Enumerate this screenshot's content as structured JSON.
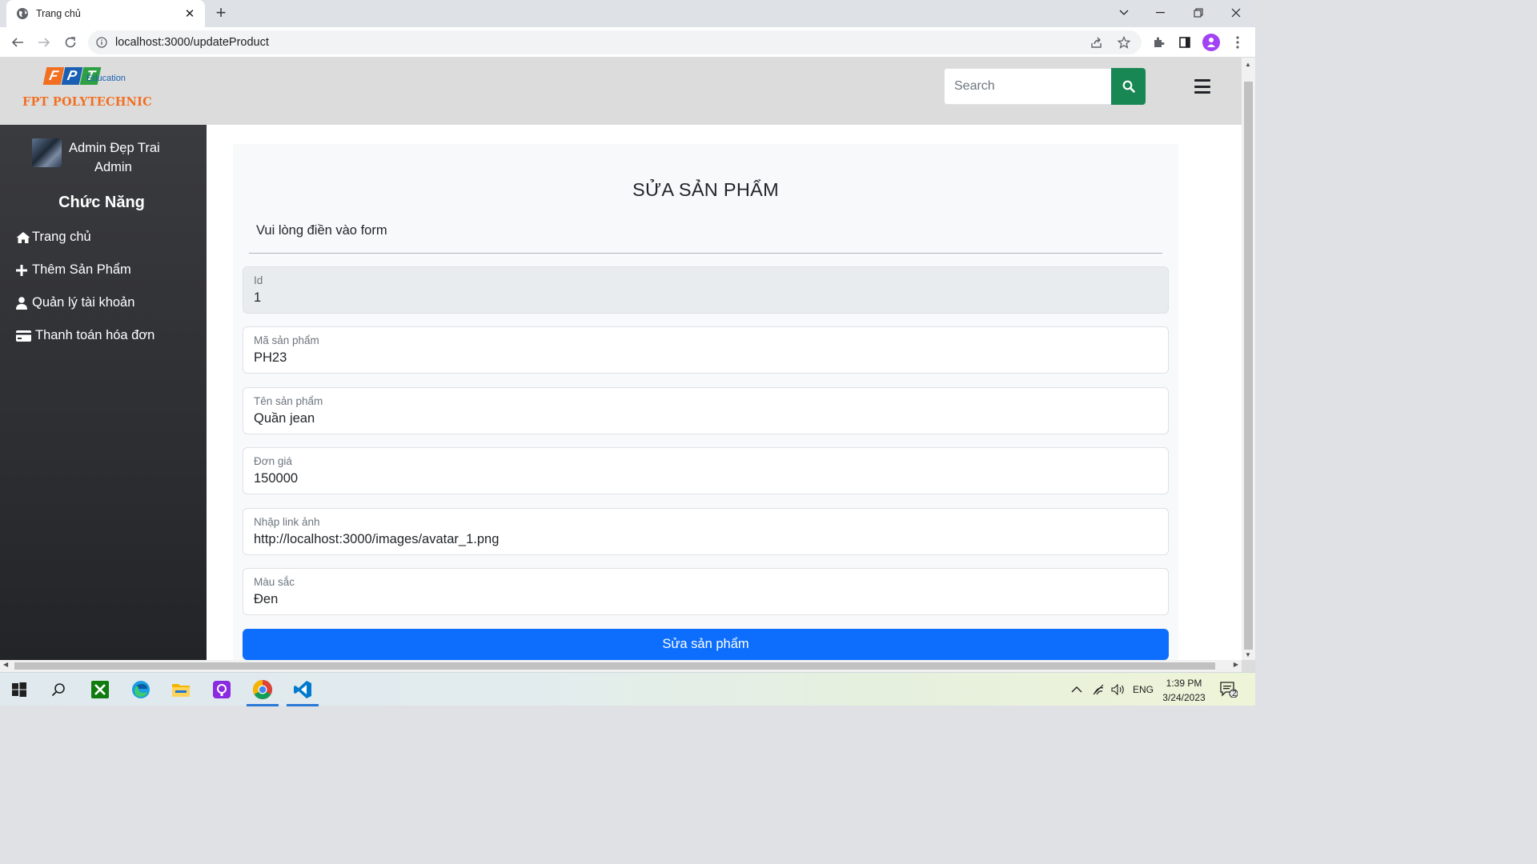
{
  "browser": {
    "tab_title": "Trang chủ",
    "tab_close": "✕",
    "new_tab": "+",
    "url": "localhost:3000/updateProduct"
  },
  "header": {
    "logo_fpt": [
      "F",
      "P",
      "T"
    ],
    "logo_fpt_colors": [
      "#f26f21",
      "#1a5fb4",
      "#2ea043"
    ],
    "logo_education": "Education",
    "logo_poly": "FPT POLYTECHNIC",
    "search_placeholder": "Search"
  },
  "sidebar": {
    "user_name": "Admin Đẹp Trai",
    "user_role": "Admin",
    "title": "Chức Năng",
    "items": [
      {
        "label": "Trang chủ",
        "icon": "home-icon"
      },
      {
        "label": "Thêm Sản Phẩm",
        "icon": "plus-icon"
      },
      {
        "label": "Quản lý tài khoản",
        "icon": "user-icon"
      },
      {
        "label": "Thanh toán hóa đơn",
        "icon": "credit-card-icon"
      }
    ]
  },
  "form": {
    "title": "SỬA SẢN PHẨM",
    "subtitle": "Vui lòng điền vào form",
    "fields": [
      {
        "label": "Id",
        "value": "1",
        "disabled": true
      },
      {
        "label": "Mã sản phẩm",
        "value": "PH23"
      },
      {
        "label": "Tên sản phẩm",
        "value": "Quần jean"
      },
      {
        "label": "Đơn giá",
        "value": "150000"
      },
      {
        "label": "Nhập link ảnh",
        "value": "http://localhost:3000/images/avatar_1.png"
      },
      {
        "label": "Màu sắc",
        "value": "Đen"
      }
    ],
    "submit_label": "Sửa sản phẩm"
  },
  "taskbar": {
    "language": "ENG",
    "time": "1:39 PM",
    "date": "3/24/2023",
    "notification_count": "2"
  },
  "colors": {
    "primary": "#0d6efd",
    "success": "#198754",
    "sidebar": "#2d2e32"
  }
}
